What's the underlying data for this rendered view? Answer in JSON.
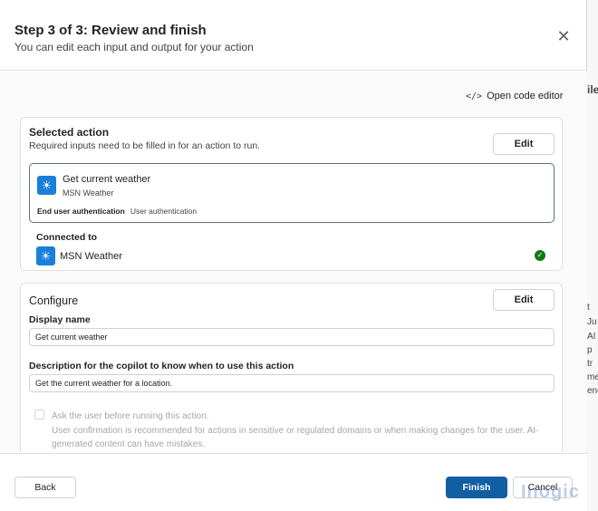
{
  "header": {
    "title": "Step 3 of 3: Review and finish",
    "subtitle": "You can edit each input and output for your action",
    "close_icon": "close-icon"
  },
  "toolbar": {
    "code_editor_label": "Open code editor",
    "code_icon": "</>"
  },
  "selected_action": {
    "title": "Selected action",
    "description": "Required inputs need to be filled in for an action to run.",
    "edit_label": "Edit",
    "action": {
      "name": "Get current weather",
      "connector": "MSN Weather",
      "auth_label": "End user authentication",
      "auth_value": "User authentication"
    },
    "connected_to_label": "Connected to",
    "connection_name": "MSN Weather",
    "connection_status": "connected"
  },
  "configure": {
    "title": "Configure",
    "edit_label": "Edit",
    "display_name_label": "Display name",
    "display_name_value": "Get current weather",
    "description_label": "Description for the copilot to know when to use this action",
    "description_value": "Get the current weather for a location.",
    "ask_user_label": "Ask the user before running this action.",
    "ask_user_help": "User confirmation is recommended for actions in sensitive or regulated domains or when making changes for the user. AI-generated content can have mistakes.",
    "ask_user_checked": false
  },
  "footer": {
    "back_label": "Back",
    "finish_label": "Finish",
    "cancel_label": "Cancel"
  },
  "watermark": "Inogic",
  "colors": {
    "primary": "#115ea3",
    "app_icon": "#1a7fd9",
    "success": "#107c10"
  }
}
